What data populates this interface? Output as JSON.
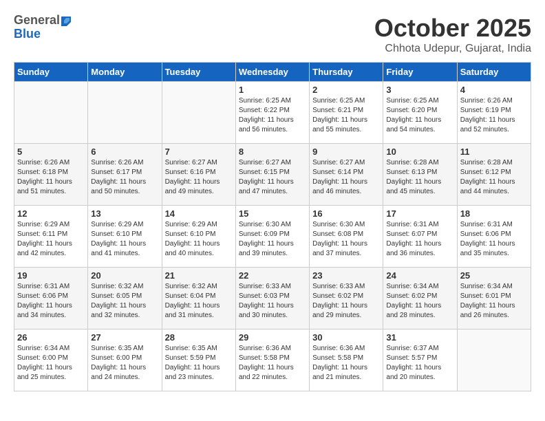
{
  "header": {
    "logo_general": "General",
    "logo_blue": "Blue",
    "month_title": "October 2025",
    "location": "Chhota Udepur, Gujarat, India"
  },
  "days_of_week": [
    "Sunday",
    "Monday",
    "Tuesday",
    "Wednesday",
    "Thursday",
    "Friday",
    "Saturday"
  ],
  "weeks": [
    [
      {
        "day": "",
        "info": ""
      },
      {
        "day": "",
        "info": ""
      },
      {
        "day": "",
        "info": ""
      },
      {
        "day": "1",
        "info": "Sunrise: 6:25 AM\nSunset: 6:22 PM\nDaylight: 11 hours\nand 56 minutes."
      },
      {
        "day": "2",
        "info": "Sunrise: 6:25 AM\nSunset: 6:21 PM\nDaylight: 11 hours\nand 55 minutes."
      },
      {
        "day": "3",
        "info": "Sunrise: 6:25 AM\nSunset: 6:20 PM\nDaylight: 11 hours\nand 54 minutes."
      },
      {
        "day": "4",
        "info": "Sunrise: 6:26 AM\nSunset: 6:19 PM\nDaylight: 11 hours\nand 52 minutes."
      }
    ],
    [
      {
        "day": "5",
        "info": "Sunrise: 6:26 AM\nSunset: 6:18 PM\nDaylight: 11 hours\nand 51 minutes."
      },
      {
        "day": "6",
        "info": "Sunrise: 6:26 AM\nSunset: 6:17 PM\nDaylight: 11 hours\nand 50 minutes."
      },
      {
        "day": "7",
        "info": "Sunrise: 6:27 AM\nSunset: 6:16 PM\nDaylight: 11 hours\nand 49 minutes."
      },
      {
        "day": "8",
        "info": "Sunrise: 6:27 AM\nSunset: 6:15 PM\nDaylight: 11 hours\nand 47 minutes."
      },
      {
        "day": "9",
        "info": "Sunrise: 6:27 AM\nSunset: 6:14 PM\nDaylight: 11 hours\nand 46 minutes."
      },
      {
        "day": "10",
        "info": "Sunrise: 6:28 AM\nSunset: 6:13 PM\nDaylight: 11 hours\nand 45 minutes."
      },
      {
        "day": "11",
        "info": "Sunrise: 6:28 AM\nSunset: 6:12 PM\nDaylight: 11 hours\nand 44 minutes."
      }
    ],
    [
      {
        "day": "12",
        "info": "Sunrise: 6:29 AM\nSunset: 6:11 PM\nDaylight: 11 hours\nand 42 minutes."
      },
      {
        "day": "13",
        "info": "Sunrise: 6:29 AM\nSunset: 6:10 PM\nDaylight: 11 hours\nand 41 minutes."
      },
      {
        "day": "14",
        "info": "Sunrise: 6:29 AM\nSunset: 6:10 PM\nDaylight: 11 hours\nand 40 minutes."
      },
      {
        "day": "15",
        "info": "Sunrise: 6:30 AM\nSunset: 6:09 PM\nDaylight: 11 hours\nand 39 minutes."
      },
      {
        "day": "16",
        "info": "Sunrise: 6:30 AM\nSunset: 6:08 PM\nDaylight: 11 hours\nand 37 minutes."
      },
      {
        "day": "17",
        "info": "Sunrise: 6:31 AM\nSunset: 6:07 PM\nDaylight: 11 hours\nand 36 minutes."
      },
      {
        "day": "18",
        "info": "Sunrise: 6:31 AM\nSunset: 6:06 PM\nDaylight: 11 hours\nand 35 minutes."
      }
    ],
    [
      {
        "day": "19",
        "info": "Sunrise: 6:31 AM\nSunset: 6:06 PM\nDaylight: 11 hours\nand 34 minutes."
      },
      {
        "day": "20",
        "info": "Sunrise: 6:32 AM\nSunset: 6:05 PM\nDaylight: 11 hours\nand 32 minutes."
      },
      {
        "day": "21",
        "info": "Sunrise: 6:32 AM\nSunset: 6:04 PM\nDaylight: 11 hours\nand 31 minutes."
      },
      {
        "day": "22",
        "info": "Sunrise: 6:33 AM\nSunset: 6:03 PM\nDaylight: 11 hours\nand 30 minutes."
      },
      {
        "day": "23",
        "info": "Sunrise: 6:33 AM\nSunset: 6:02 PM\nDaylight: 11 hours\nand 29 minutes."
      },
      {
        "day": "24",
        "info": "Sunrise: 6:34 AM\nSunset: 6:02 PM\nDaylight: 11 hours\nand 28 minutes."
      },
      {
        "day": "25",
        "info": "Sunrise: 6:34 AM\nSunset: 6:01 PM\nDaylight: 11 hours\nand 26 minutes."
      }
    ],
    [
      {
        "day": "26",
        "info": "Sunrise: 6:34 AM\nSunset: 6:00 PM\nDaylight: 11 hours\nand 25 minutes."
      },
      {
        "day": "27",
        "info": "Sunrise: 6:35 AM\nSunset: 6:00 PM\nDaylight: 11 hours\nand 24 minutes."
      },
      {
        "day": "28",
        "info": "Sunrise: 6:35 AM\nSunset: 5:59 PM\nDaylight: 11 hours\nand 23 minutes."
      },
      {
        "day": "29",
        "info": "Sunrise: 6:36 AM\nSunset: 5:58 PM\nDaylight: 11 hours\nand 22 minutes."
      },
      {
        "day": "30",
        "info": "Sunrise: 6:36 AM\nSunset: 5:58 PM\nDaylight: 11 hours\nand 21 minutes."
      },
      {
        "day": "31",
        "info": "Sunrise: 6:37 AM\nSunset: 5:57 PM\nDaylight: 11 hours\nand 20 minutes."
      },
      {
        "day": "",
        "info": ""
      }
    ]
  ]
}
